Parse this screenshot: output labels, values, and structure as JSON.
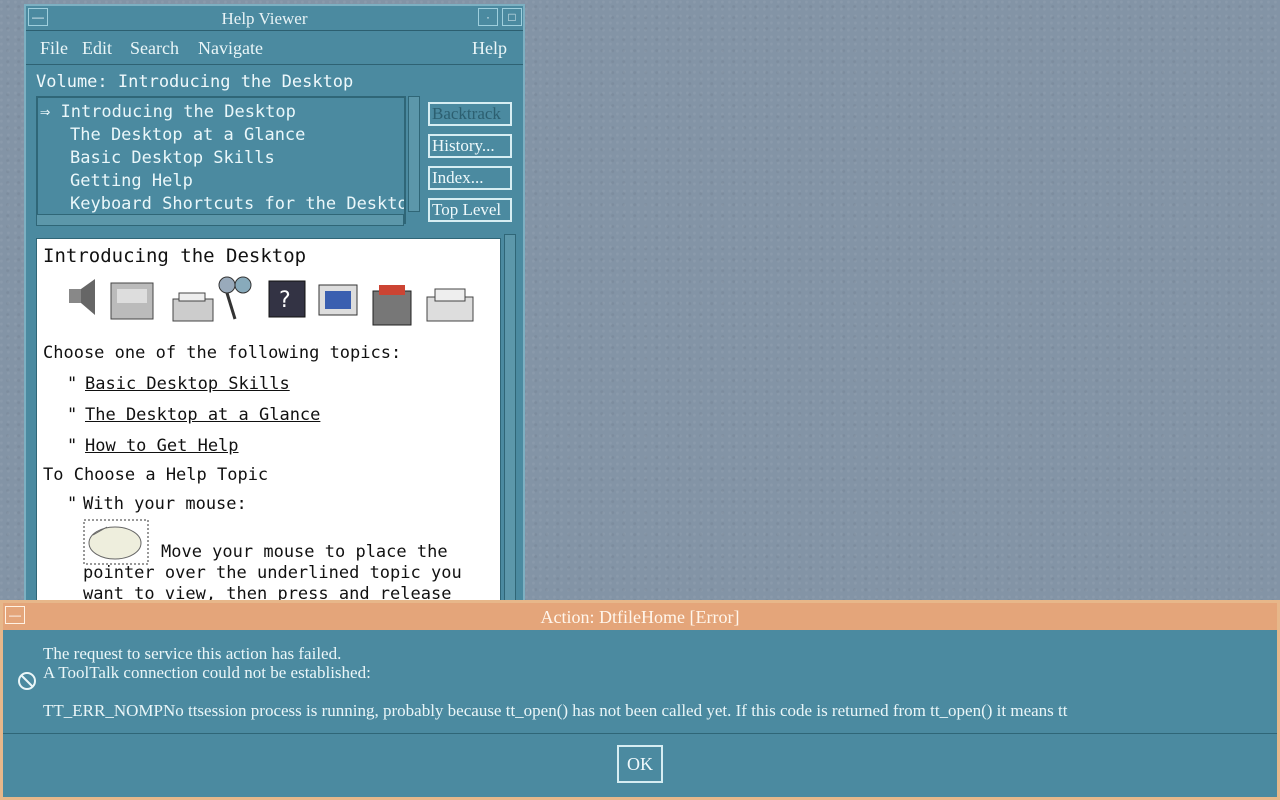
{
  "help_window": {
    "title": "Help Viewer",
    "menu": [
      "File",
      "Edit",
      "Search",
      "Navigate"
    ],
    "menu_help": "Help",
    "volume_line": "Volume: Introducing the Desktop",
    "topics": [
      "⇒ Introducing the Desktop",
      "The Desktop at a Glance",
      "Basic Desktop Skills",
      "Getting Help",
      "Keyboard Shortcuts for the Desktop"
    ],
    "buttons": [
      "Backtrack",
      "History...",
      "Index...",
      "Top Level"
    ],
    "content": {
      "heading": "Introducing the Desktop",
      "choose_line": "Choose one of the following topics:",
      "links": [
        "Basic Desktop Skills",
        "The Desktop at a Glance",
        "How to Get Help"
      ],
      "bullet_char": "\"",
      "section_title": "To Choose a Help Topic",
      "with_mouse": "With your mouse:",
      "para_line1": "Move your mouse to place the",
      "para_line2": "pointer over the underlined topic you",
      "para_line3": "want to view, then press and release"
    }
  },
  "dialog": {
    "title": "Action: DtfileHome [Error]",
    "line1": "The request to service this action has failed.",
    "line2": "A ToolTalk connection could not be established:",
    "line3": "TT_ERR_NOMPNo ttsession process is running, probably because tt_open() has not been called yet. If this code is returned from tt_open() it means tt",
    "ok": "OK"
  },
  "colors": {
    "desktop": "#8394a6",
    "window": "#4b8aa0",
    "dialog_title": "#e4a57a",
    "content_bg": "#ffffff"
  }
}
